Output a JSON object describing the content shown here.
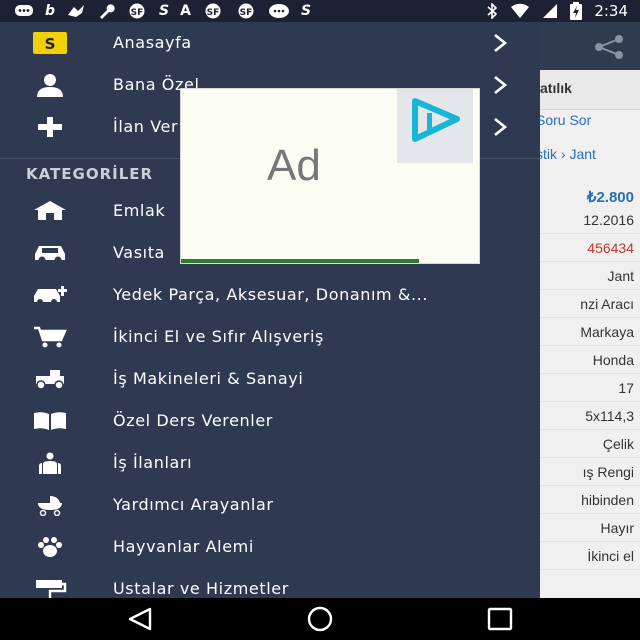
{
  "status_bar": {
    "left_icons": [
      "messenger-icon",
      "b",
      "bird-icon",
      "wrench-icon",
      "sahibinden-icon",
      "S",
      "A",
      "sahibinden-icon",
      "sahibinden-icon",
      "messages-icon",
      "S"
    ],
    "b_glyph": "b",
    "s_glyph": "S",
    "a_glyph": "A",
    "time": "2:34"
  },
  "drawer": {
    "main_items": [
      {
        "label": "Anasayfa",
        "icon": "s-logo-icon",
        "has_chevron": true
      },
      {
        "label": "Bana Özel",
        "icon": "person-icon",
        "has_chevron": true
      },
      {
        "label": "İlan Ver",
        "icon": "plus-icon",
        "has_chevron": true
      }
    ],
    "logo_letter": "S",
    "section_title": "KATEGORİLER",
    "categories": [
      {
        "label": "Emlak",
        "icon": "house-icon"
      },
      {
        "label": "Vasıta",
        "icon": "car-icon"
      },
      {
        "label": "Yedek Parça, Aksesuar, Donanım &...",
        "icon": "car-parts-icon"
      },
      {
        "label": "İkinci El ve Sıfır Alışveriş",
        "icon": "cart-icon"
      },
      {
        "label": "İş Makineleri & Sanayi",
        "icon": "tractor-icon"
      },
      {
        "label": "Özel Ders Verenler",
        "icon": "book-icon"
      },
      {
        "label": "İş İlanları",
        "icon": "people-icon"
      },
      {
        "label": "Yardımcı Arayanlar",
        "icon": "stroller-icon"
      },
      {
        "label": "Hayvanlar Alemi",
        "icon": "paw-icon"
      },
      {
        "label": "Ustalar ve Hizmetler",
        "icon": "paint-roller-icon"
      }
    ]
  },
  "background_page": {
    "tab_label": "atılık",
    "link_soru_sor": "Soru Sor",
    "breadcrumb": "stik › Jant",
    "price": "₺2.800",
    "rows": [
      {
        "text": "12.2016",
        "red": false
      },
      {
        "text": "456434",
        "red": true
      },
      {
        "text": "Jant",
        "red": false
      },
      {
        "text": "nzi Aracı",
        "red": false
      },
      {
        "text": "Markaya",
        "red": false
      },
      {
        "text": "Honda",
        "red": false
      },
      {
        "text": "17",
        "red": false
      },
      {
        "text": "5x114,3",
        "red": false
      },
      {
        "text": "Çelik",
        "red": false
      },
      {
        "text": "ış Rengi",
        "red": false
      },
      {
        "text": "hibinden",
        "red": false
      },
      {
        "text": "Hayır",
        "red": false
      },
      {
        "text": "İkinci el",
        "red": false
      }
    ]
  },
  "ad": {
    "text": "Ad"
  },
  "colors": {
    "drawer_bg": "#2f3a52",
    "accent_yellow": "#f5d000",
    "link_blue": "#2a6fb5",
    "ad_badge_cyan": "#19b5d6"
  }
}
